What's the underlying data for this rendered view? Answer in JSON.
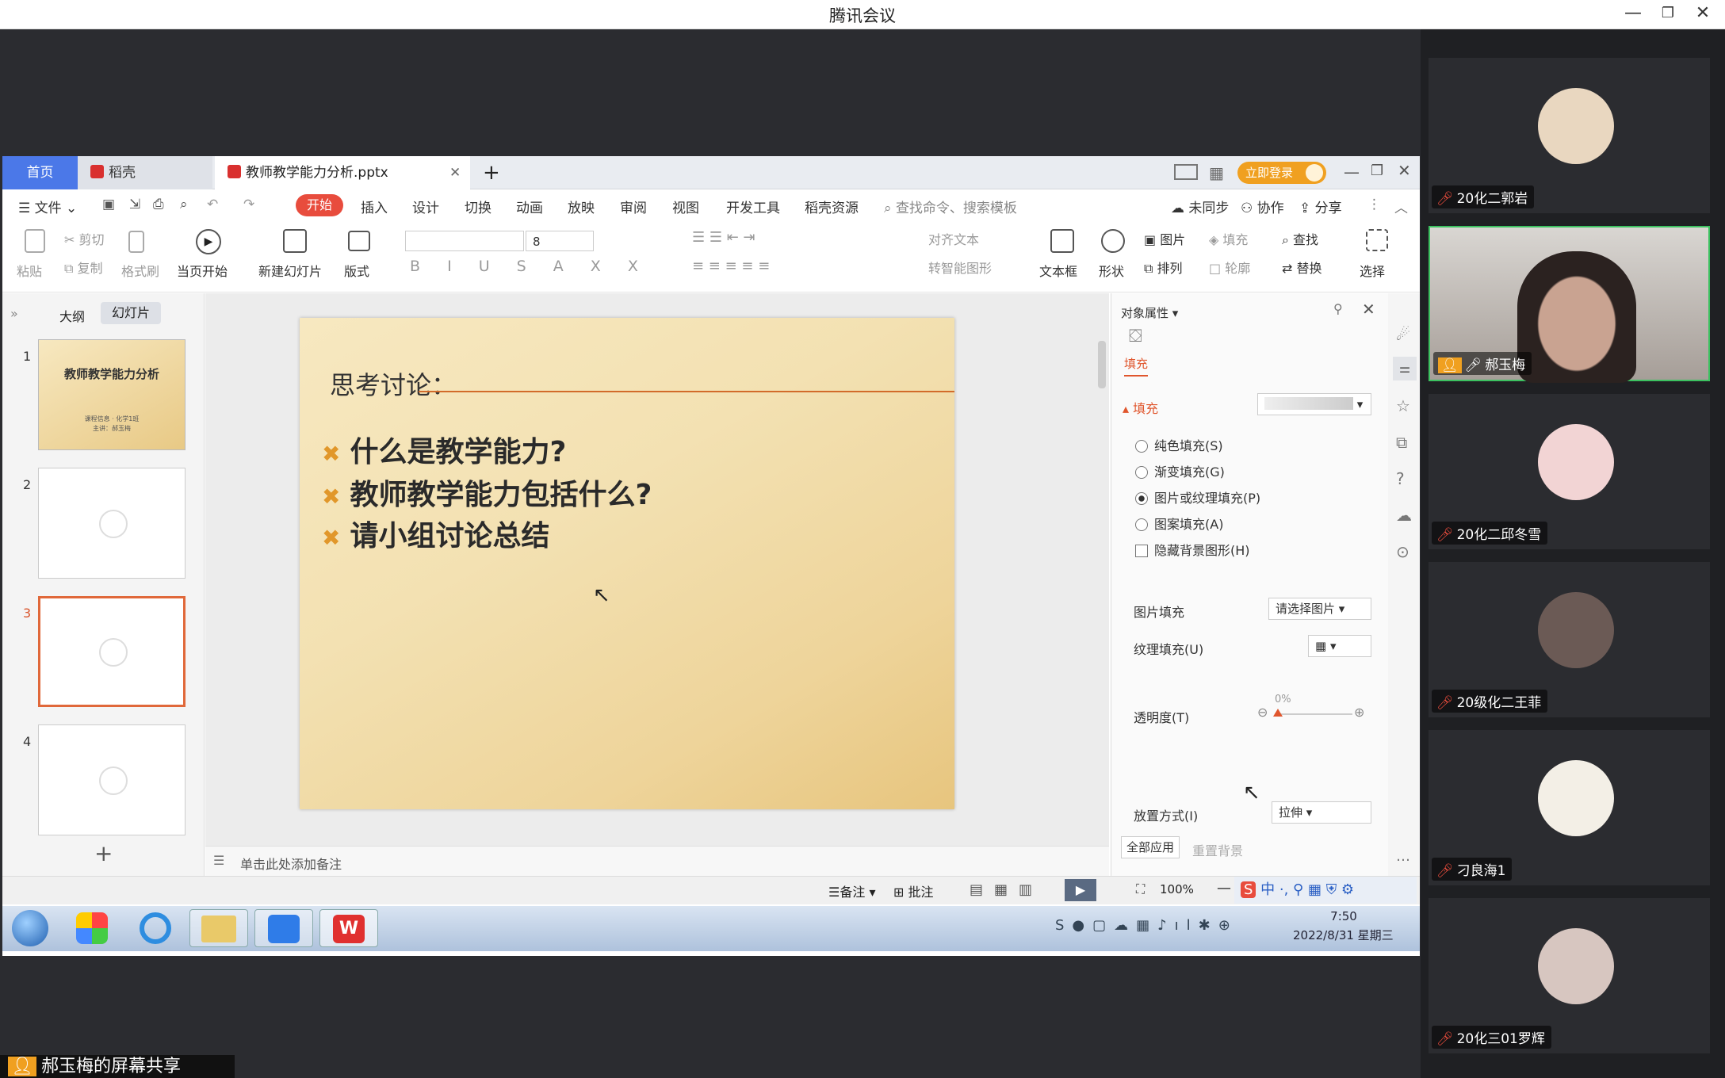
{
  "window": {
    "title": "腾讯会议"
  },
  "wps": {
    "tabs": {
      "home": "首页",
      "daoke": "稻壳",
      "doc": "教师教学能力分析.pptx",
      "add": "+"
    },
    "login": "立即登录",
    "menu": {
      "file": "文件",
      "items": [
        "开始",
        "插入",
        "设计",
        "切换",
        "动画",
        "放映",
        "审阅",
        "视图",
        "开发工具",
        "稻壳资源"
      ],
      "search": "查找命令、搜索模板",
      "sync": "未同步",
      "collab": "协作",
      "share": "分享"
    },
    "ribbon": {
      "paste": "粘贴",
      "cut": "剪切",
      "copy": "复制",
      "format_painter": "格式刷",
      "from_current": "当页开始",
      "new_slide": "新建幻灯片",
      "layout": "版式",
      "font_size": "8",
      "align_text": "对齐文本",
      "smart_shape": "转智能图形",
      "textbox": "文本框",
      "shape": "形状",
      "picture": "图片",
      "fill": "填充",
      "arrange": "排列",
      "outline": "轮廓",
      "find": "查找",
      "replace": "替换",
      "select": "选择"
    },
    "panel_tabs": {
      "outline": "大纲",
      "slides": "幻灯片"
    },
    "thumbs": [
      {
        "num": "1",
        "title": "教师教学能力分析",
        "sub1": "课程信息 · 化学1班",
        "sub2": "主讲：郝玉梅"
      },
      {
        "num": "2"
      },
      {
        "num": "3"
      },
      {
        "num": "4"
      }
    ],
    "slide": {
      "title": "思考讨论：",
      "bullets": [
        "什么是教学能力?",
        "教师教学能力包括什么?",
        "请小组讨论总结"
      ]
    },
    "notes_placeholder": "单击此处添加备注",
    "props": {
      "header": "对象属性",
      "tab": "填充",
      "section": "填充",
      "options": [
        "纯色填充(S)",
        "渐变填充(G)",
        "图片或纹理填充(P)",
        "图案填充(A)"
      ],
      "selected_option": 2,
      "hide_bg": "隐藏背景图形(H)",
      "pic_fill_label": "图片填充",
      "pic_fill_value": "请选择图片",
      "texture_label": "纹理填充(U)",
      "transparency_label": "透明度(T)",
      "transparency_value": "0%",
      "placement_label": "放置方式(I)",
      "placement_value": "拉伸",
      "apply_all": "全部应用",
      "reset_bg": "重置背景"
    },
    "status": {
      "notes": "备注",
      "comment": "批注",
      "zoom": "100%"
    }
  },
  "taskbar": {
    "time": "7:50",
    "date": "2022/8/31 星期三",
    "ime": "中"
  },
  "participants": [
    {
      "name": "20化二郭岩",
      "color": "#e9d7c0"
    },
    {
      "name": "郝玉梅",
      "color": "#8a7f78"
    },
    {
      "name": "20化二邱冬雪",
      "color": "#f2d4d4"
    },
    {
      "name": "20级化二王菲",
      "color": "#6b5a55"
    },
    {
      "name": "刁良海1",
      "color": "#f3efe6"
    },
    {
      "name": "20化三01罗辉",
      "color": "#d7c6c0"
    }
  ],
  "share_label": "郝玉梅的屏幕共享"
}
